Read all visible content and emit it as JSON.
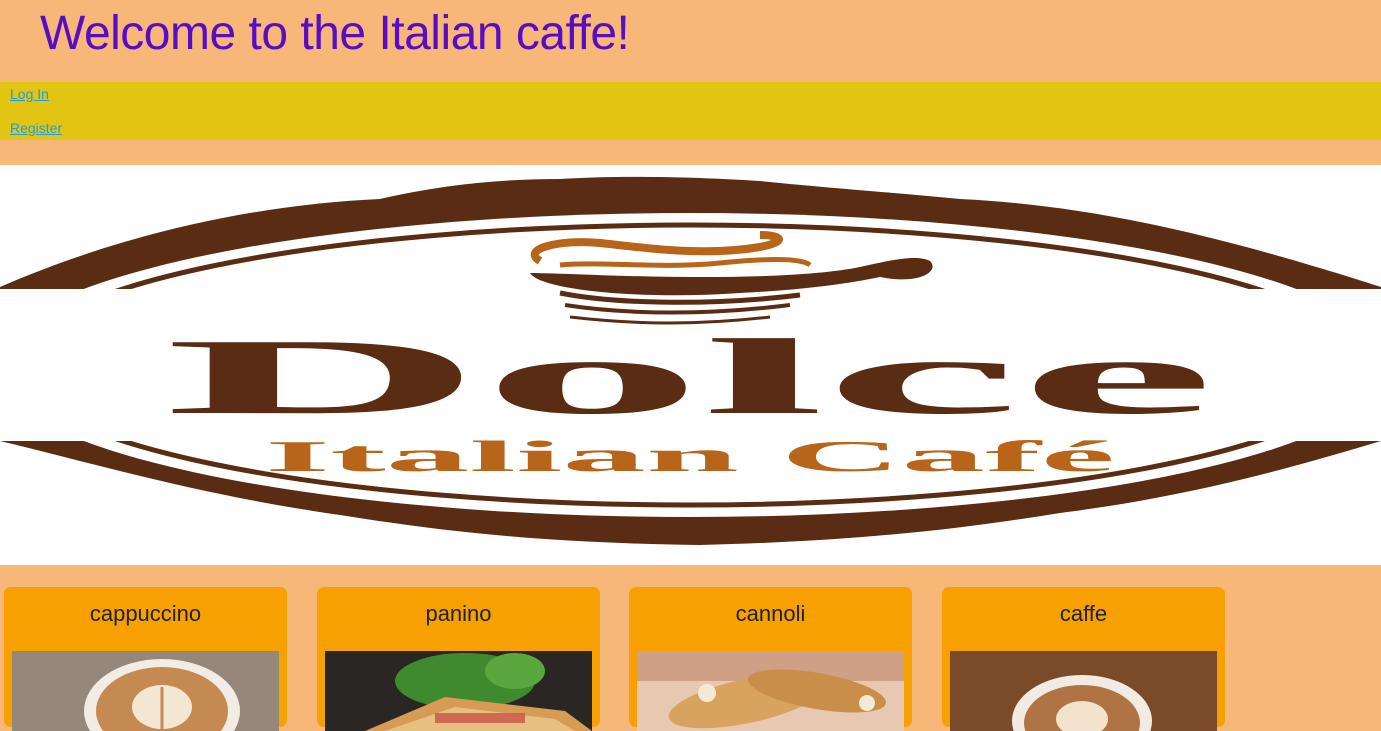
{
  "header": {
    "title": "Welcome to the Italian caffe!"
  },
  "nav": {
    "links": [
      {
        "label": "Log In"
      },
      {
        "label": "Register"
      }
    ]
  },
  "banner": {
    "logo_word": "Dolce",
    "logo_subtitle": "Italian Café"
  },
  "menu": {
    "items": [
      {
        "name": "cappuccino"
      },
      {
        "name": "panino"
      },
      {
        "name": "cannoli"
      },
      {
        "name": "caffe"
      }
    ]
  },
  "colors": {
    "background": "#f6b778",
    "nav_bar": "#e2c413",
    "title": "#5a0cc4",
    "link": "#1d9fd6",
    "card": "#f7a001",
    "logo_brown": "#5a2c14",
    "logo_orange": "#b8641a"
  }
}
